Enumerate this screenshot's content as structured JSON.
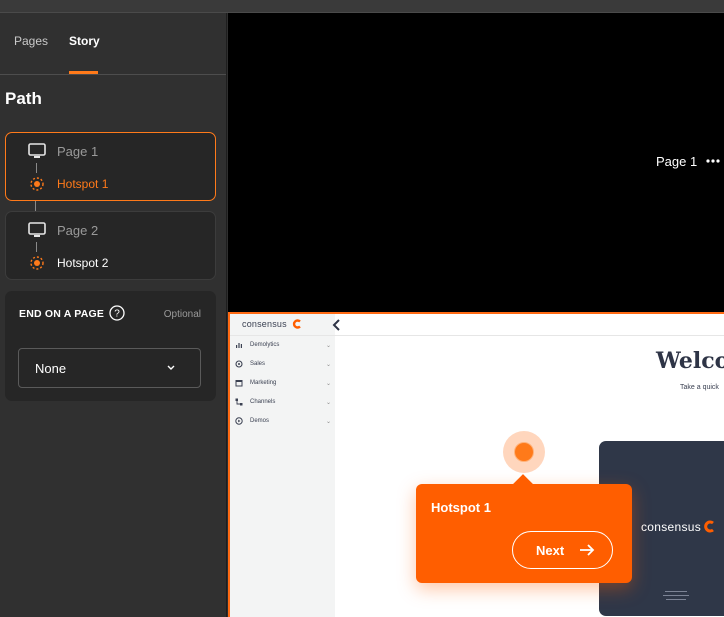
{
  "sidebar": {
    "tabs": [
      {
        "label": "Pages"
      },
      {
        "label": "Story"
      }
    ],
    "path_title": "Path",
    "steps": [
      {
        "page": "Page 1",
        "hotspot": "Hotspot 1"
      },
      {
        "page": "Page 2",
        "hotspot": "Hotspot 2"
      }
    ],
    "end_on_page": {
      "title": "END ON A PAGE",
      "optional_label": "Optional",
      "selected": "None"
    }
  },
  "preview": {
    "page_name": "Page 1",
    "app": {
      "logo_text": "consensus",
      "nav_items": [
        {
          "label": "Demolytics",
          "icon": "bar-chart-icon"
        },
        {
          "label": "Sales",
          "icon": "tag-icon"
        },
        {
          "label": "Marketing",
          "icon": "calendar-icon"
        },
        {
          "label": "Channels",
          "icon": "network-icon"
        },
        {
          "label": "Demos",
          "icon": "play-icon"
        }
      ],
      "welcome": "Welco",
      "take_text": "Take a quick",
      "card_logo": "consensus"
    },
    "tooltip": {
      "title": "Hotspot 1",
      "next_label": "Next"
    }
  },
  "colors": {
    "accent": "#ff7a1a",
    "tooltip_bg": "#ff5e00",
    "sidebar_bg": "#303030"
  }
}
